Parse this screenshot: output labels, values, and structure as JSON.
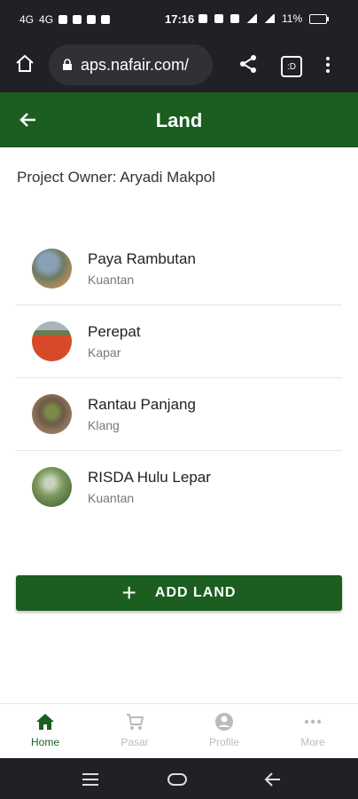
{
  "status_bar": {
    "left_icons": [
      "4G-signal-icon",
      "4G-signal-icon",
      "gallery-icon",
      "messenger-icon",
      "cloud-icon",
      "youtube-icon"
    ],
    "left_labels": [
      "4G",
      "4G"
    ],
    "time": "17:16",
    "battery": "11%"
  },
  "browser": {
    "url": "aps.nafair.com/",
    "tabs_label": ":D"
  },
  "app_bar": {
    "title": "Land"
  },
  "owner": {
    "text": "Project Owner: Aryadi Makpol"
  },
  "lands": [
    {
      "name": "Paya Rambutan",
      "location": "Kuantan"
    },
    {
      "name": "Perepat",
      "location": "Kapar"
    },
    {
      "name": "Rantau Panjang",
      "location": "Klang"
    },
    {
      "name": "RISDA Hulu Lepar",
      "location": "Kuantan"
    }
  ],
  "actions": {
    "add_land_label": "ADD LAND"
  },
  "bottom_nav": [
    {
      "label": "Home",
      "icon": "home-icon",
      "active": true
    },
    {
      "label": "Pasar",
      "icon": "cart-icon",
      "active": false
    },
    {
      "label": "Profile",
      "icon": "profile-icon",
      "active": false
    },
    {
      "label": "More",
      "icon": "more-icon",
      "active": false
    }
  ],
  "colors": {
    "primary": "#1b5e20",
    "status_bar": "#202124"
  }
}
